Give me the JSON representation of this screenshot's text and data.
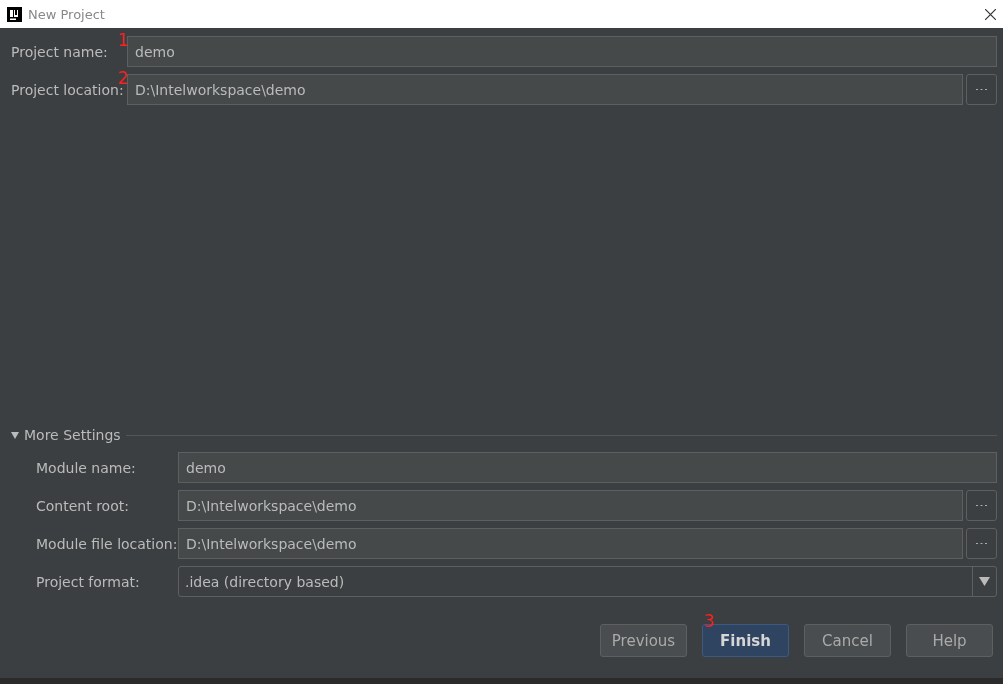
{
  "window": {
    "title": "New Project"
  },
  "fields": [
    {
      "label": "Project name:",
      "marker": "1",
      "value": "demo",
      "kind": "text"
    },
    {
      "label": "Project location:",
      "marker": "2",
      "value": "D:\\Intelworkspace\\demo",
      "kind": "path"
    }
  ],
  "more_settings": {
    "title": "More Settings",
    "expanded": true,
    "fields": [
      {
        "label": "Module name:",
        "value": "demo",
        "kind": "text"
      },
      {
        "label": "Content root:",
        "value": "D:\\Intelworkspace\\demo",
        "kind": "path"
      },
      {
        "label": "Module file location:",
        "value": "D:\\Intelworkspace\\demo",
        "kind": "path"
      },
      {
        "label": "Project format:",
        "value": ".idea (directory based)",
        "kind": "select"
      }
    ]
  },
  "buttons": [
    {
      "label": "Previous",
      "kind": "normal"
    },
    {
      "label": "Finish",
      "kind": "default",
      "marker": "3"
    },
    {
      "label": "Cancel",
      "kind": "normal"
    },
    {
      "label": "Help",
      "kind": "normal"
    }
  ]
}
